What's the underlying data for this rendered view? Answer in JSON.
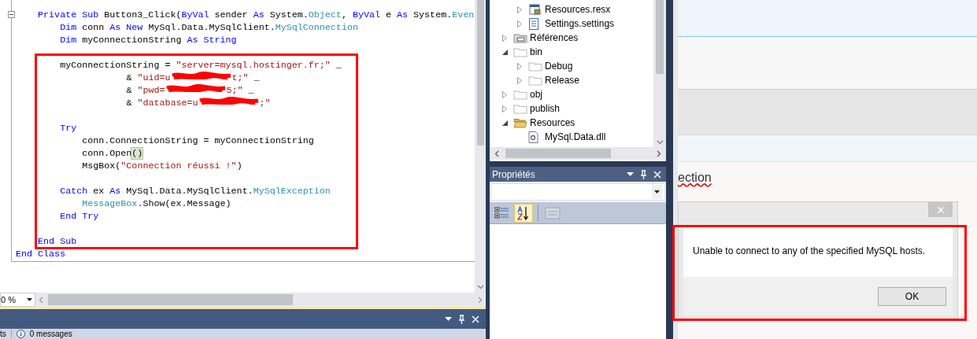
{
  "editor": {
    "code_blocks": [
      {
        "lines": [
          {
            "tokens": [
              {
                "kind": "kw",
                "text": "    Private Sub"
              },
              {
                "kind": "plain",
                "text": " Button3_Click("
              },
              {
                "kind": "kw",
                "text": "ByVal"
              },
              {
                "kind": "plain",
                "text": " sender "
              },
              {
                "kind": "kw",
                "text": "As"
              },
              {
                "kind": "plain",
                "text": " System."
              },
              {
                "kind": "type",
                "text": "Object"
              },
              {
                "kind": "plain",
                "text": ", "
              },
              {
                "kind": "kw",
                "text": "ByVal"
              },
              {
                "kind": "plain",
                "text": " e "
              },
              {
                "kind": "kw",
                "text": "As"
              },
              {
                "kind": "plain",
                "text": " System."
              },
              {
                "kind": "type",
                "text": "Even"
              }
            ]
          },
          {
            "tokens": [
              {
                "kind": "kw",
                "text": "        Dim"
              },
              {
                "kind": "plain",
                "text": " conn "
              },
              {
                "kind": "kw",
                "text": "As New"
              },
              {
                "kind": "plain",
                "text": " MySql.Data.MySqlClient."
              },
              {
                "kind": "type",
                "text": "MySqlConnection"
              }
            ]
          },
          {
            "tokens": [
              {
                "kind": "kw",
                "text": "        Dim"
              },
              {
                "kind": "plain",
                "text": " myConnectionString "
              },
              {
                "kind": "kw",
                "text": "As String"
              }
            ]
          }
        ]
      },
      {
        "lines": [
          {
            "tokens": [
              {
                "kind": "plain",
                "text": "        myConnectionString = "
              },
              {
                "kind": "str",
                "text": "\"server=mysql.hostinger.fr;\""
              },
              {
                "kind": "plain",
                "text": " _"
              }
            ]
          },
          {
            "tokens": [
              {
                "kind": "plain",
                "text": "                    & "
              },
              {
                "kind": "str",
                "text": "\"uid=u"
              },
              {
                "kind": "redact"
              },
              {
                "kind": "str",
                "text": "t;\""
              },
              {
                "kind": "plain",
                "text": " _"
              }
            ]
          },
          {
            "tokens": [
              {
                "kind": "plain",
                "text": "                    & "
              },
              {
                "kind": "str",
                "text": "\"pwd="
              },
              {
                "kind": "redact"
              },
              {
                "kind": "str",
                "text": "5;\""
              },
              {
                "kind": "plain",
                "text": " _"
              }
            ]
          },
          {
            "tokens": [
              {
                "kind": "plain",
                "text": "                    & "
              },
              {
                "kind": "str",
                "text": "\"database=u"
              },
              {
                "kind": "redact"
              },
              {
                "kind": "str",
                "text": ";\""
              }
            ]
          }
        ]
      },
      {
        "lines": [
          {
            "tokens": [
              {
                "kind": "kw",
                "text": "        Try"
              }
            ]
          },
          {
            "tokens": [
              {
                "kind": "plain",
                "text": "            conn.ConnectionString = myConnectionString"
              }
            ]
          },
          {
            "tokens": [
              {
                "kind": "plain",
                "text": "            conn.Open"
              },
              {
                "kind": "match",
                "text": "()"
              }
            ]
          },
          {
            "tokens": [
              {
                "kind": "plain",
                "text": "            MsgBox("
              },
              {
                "kind": "str",
                "text": "\"Connection réussi !\""
              },
              {
                "kind": "plain",
                "text": ")"
              }
            ]
          }
        ]
      },
      {
        "lines": [
          {
            "tokens": [
              {
                "kind": "kw",
                "text": "        Catch"
              },
              {
                "kind": "plain",
                "text": " ex "
              },
              {
                "kind": "kw",
                "text": "As"
              },
              {
                "kind": "plain",
                "text": " MySql.Data.MySqlClient."
              },
              {
                "kind": "type",
                "text": "MySqlException"
              }
            ]
          },
          {
            "tokens": [
              {
                "kind": "type",
                "text": "            MessageBox"
              },
              {
                "kind": "plain",
                "text": ".Show(ex.Message)"
              }
            ]
          },
          {
            "tokens": [
              {
                "kind": "kw",
                "text": "        End Try"
              }
            ]
          }
        ]
      },
      {
        "lines": [
          {
            "tokens": [
              {
                "kind": "kw",
                "text": "    End Sub"
              }
            ]
          },
          {
            "tokens": [
              {
                "kind": "kw",
                "text": "End Class"
              }
            ]
          }
        ]
      }
    ],
    "zoom": "0 %"
  },
  "output_panel": {
    "tab_fragment": "ts",
    "messages": "0 messages"
  },
  "solution_tree": {
    "continued_items": [
      {
        "label": "Resources.resx",
        "kind": "resx",
        "expanded": false
      },
      {
        "label": "Settings.settings",
        "kind": "settings",
        "expanded": false
      }
    ],
    "items": [
      {
        "label": "Références",
        "kind": "references",
        "expanded": false
      },
      {
        "label": "bin",
        "kind": "folder",
        "expanded": true,
        "children": [
          {
            "label": "Debug",
            "kind": "folder",
            "expanded": false
          },
          {
            "label": "Release",
            "kind": "folder",
            "expanded": false
          }
        ]
      },
      {
        "label": "obj",
        "kind": "folder",
        "expanded": false
      },
      {
        "label": "publish",
        "kind": "folder",
        "expanded": false
      },
      {
        "label": "Resources",
        "kind": "folder_open",
        "expanded": true,
        "children": [
          {
            "label": "MySql.Data.dll",
            "kind": "dll"
          }
        ]
      }
    ]
  },
  "properties": {
    "title": "Propriétés",
    "toolbar": [
      {
        "kind": "categorized",
        "selected": false,
        "disabled": false
      },
      {
        "kind": "alphabetical",
        "selected": true,
        "disabled": false
      },
      {
        "kind": "property_pages",
        "selected": false,
        "disabled": true
      }
    ]
  },
  "app": {
    "heading_fragment": "ection"
  },
  "dialog": {
    "message": "Unable to connect to any of the specified MySQL hosts.",
    "button": "OK"
  }
}
